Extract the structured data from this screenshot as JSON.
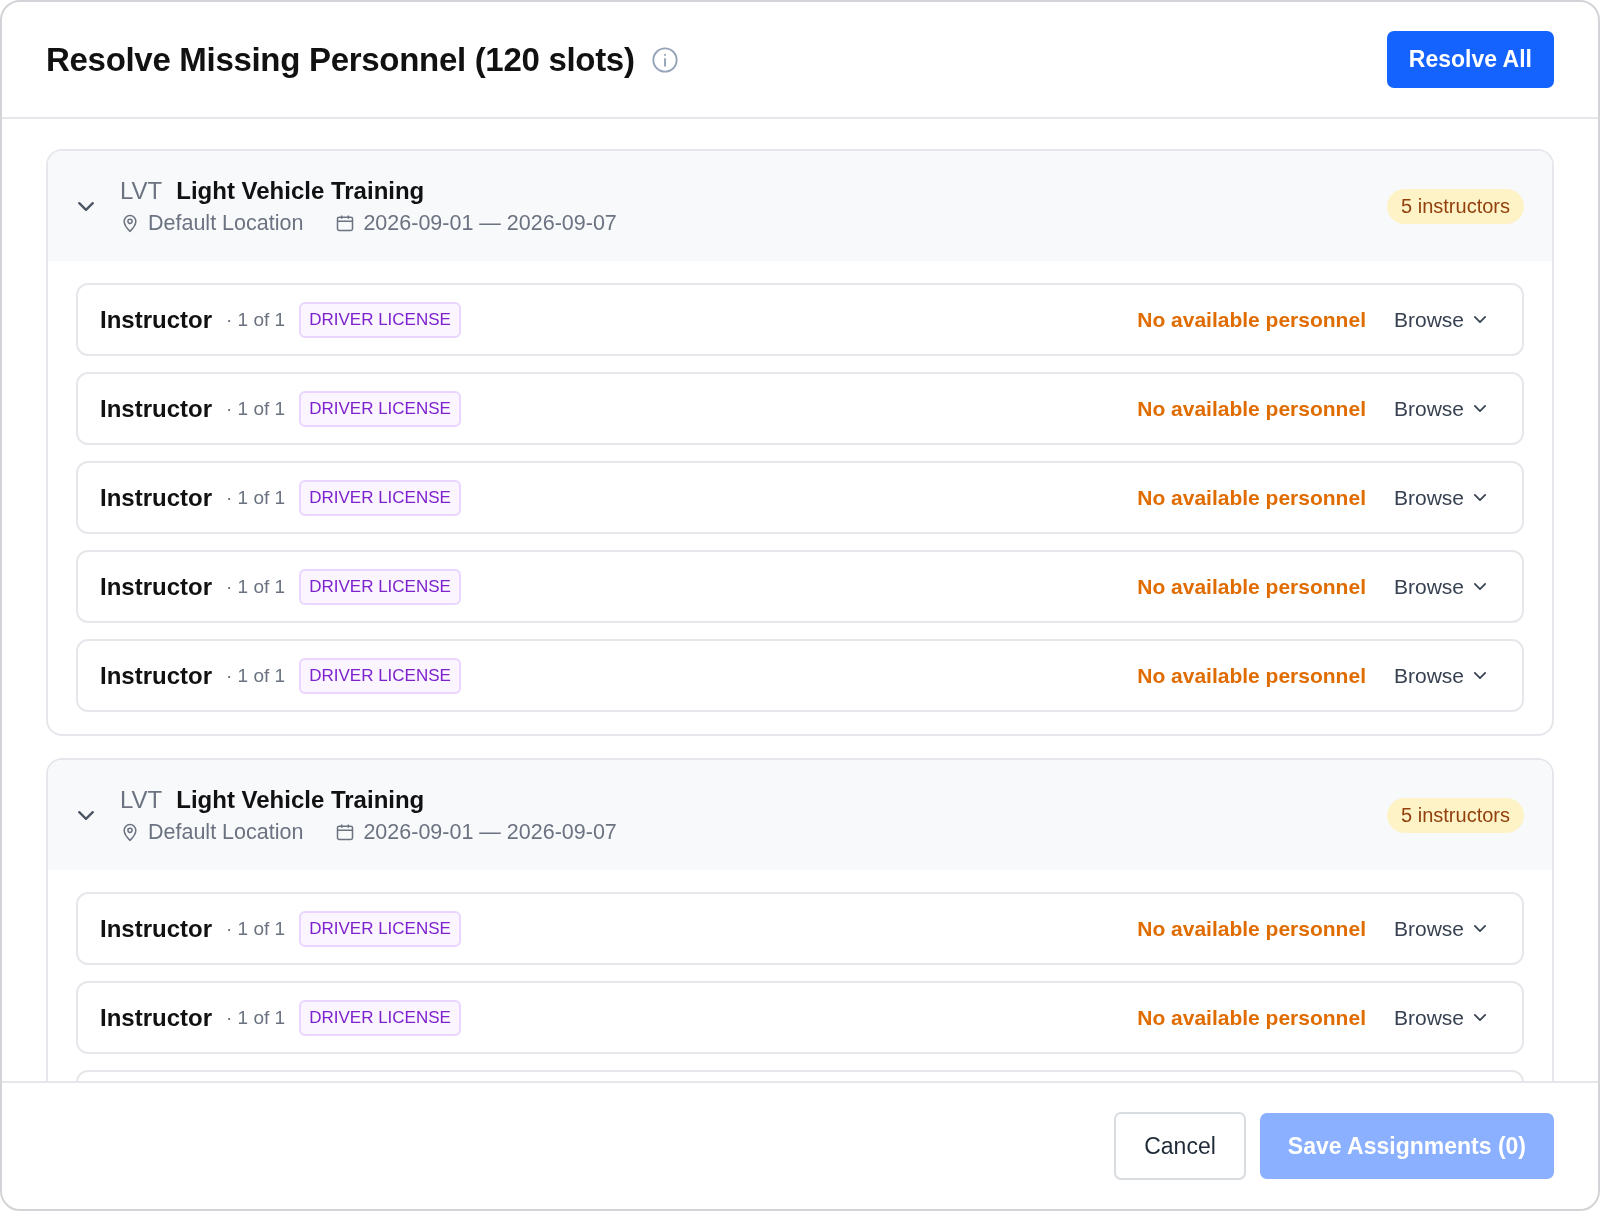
{
  "dialog": {
    "title": "Resolve Missing Personnel (120 slots)",
    "primary_action": "Resolve All"
  },
  "groups": [
    {
      "expanded": true,
      "code": "LVT",
      "name": "Light Vehicle Training",
      "location": "Default Location",
      "dates": "2026-09-01 — 2026-09-07",
      "badge": "5 instructors",
      "slots": [
        {
          "kind": "slot",
          "role": "Instructor",
          "count": "· 1 of 1",
          "tag": "DRIVER LICENSE",
          "status": "No available personnel",
          "action": "Browse"
        },
        {
          "kind": "slot",
          "role": "Instructor",
          "count": "· 1 of 1",
          "tag": "DRIVER LICENSE",
          "status": "No available personnel",
          "action": "Browse"
        },
        {
          "kind": "slot",
          "role": "Instructor",
          "count": "· 1 of 1",
          "tag": "DRIVER LICENSE",
          "status": "No available personnel",
          "action": "Browse"
        },
        {
          "kind": "slot",
          "role": "Instructor",
          "count": "· 1 of 1",
          "tag": "DRIVER LICENSE",
          "status": "No available personnel",
          "action": "Browse"
        },
        {
          "kind": "slot",
          "role": "Instructor",
          "count": "· 1 of 1",
          "tag": "DRIVER LICENSE",
          "status": "No available personnel",
          "action": "Browse"
        }
      ]
    },
    {
      "expanded": true,
      "code": "LVT",
      "name": "Light Vehicle Training",
      "location": "Default Location",
      "dates": "2026-09-01 — 2026-09-07",
      "badge": "5 instructors",
      "slots": [
        {
          "kind": "slot",
          "role": "Instructor",
          "count": "· 1 of 1",
          "tag": "DRIVER LICENSE",
          "status": "No available personnel",
          "action": "Browse"
        },
        {
          "kind": "slot",
          "role": "Instructor",
          "count": "· 1 of 1",
          "tag": "DRIVER LICENSE",
          "status": "No available personnel",
          "action": "Browse"
        },
        {
          "kind": "clipped"
        }
      ]
    }
  ],
  "footer": {
    "cancel": "Cancel",
    "save": {
      "label": "Save Assignments (0)",
      "disabled": true
    }
  }
}
